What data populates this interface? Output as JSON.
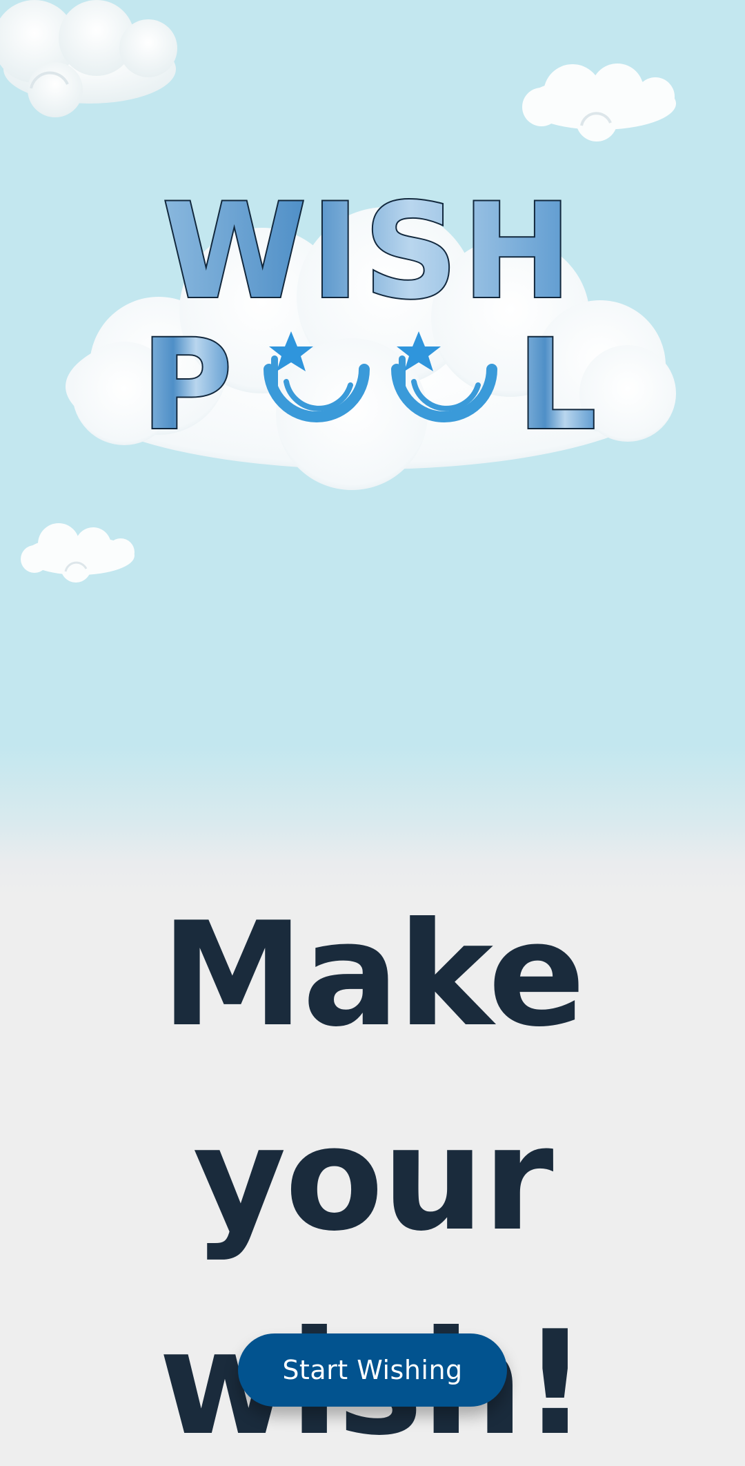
{
  "logo": {
    "line1": "WISH",
    "line2_left": "P",
    "line2_right": "L",
    "alt_word": "WISH POOL"
  },
  "headline": {
    "line1": "Make your",
    "line2": "wish!"
  },
  "cta": {
    "label": "Start Wishing"
  },
  "colors": {
    "sky": "#c3e7ef",
    "ground": "#eeeeee",
    "headline": "#1a2b3c",
    "button": "#02538f",
    "button_text": "#ffffff",
    "logo_blue": "#3a9ad9"
  },
  "icons": [
    "cloud-icon",
    "star-icon",
    "moon-swirl-icon"
  ]
}
